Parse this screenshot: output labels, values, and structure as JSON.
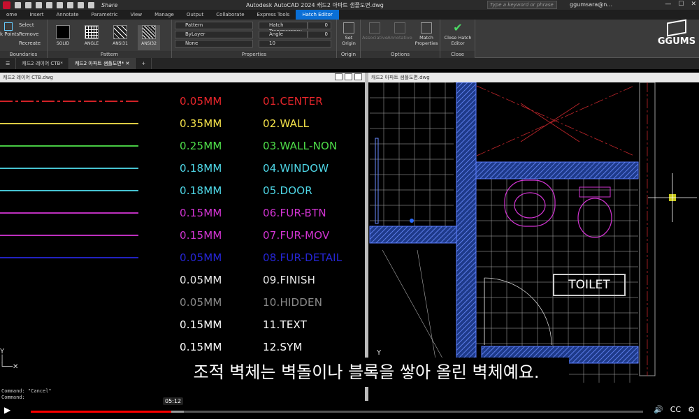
{
  "titlebar": {
    "share_label": "Share",
    "title": "Autodesk AutoCAD 2024    캐드2 아파트 샘플도면.dwg",
    "search_placeholder": "Type a keyword or phrase",
    "user": "ggumsara@n...",
    "min_icon": "minimize-icon",
    "max_icon": "maximize-icon",
    "close_icon": "close-icon"
  },
  "ribbon_tabs": [
    "ome",
    "Insert",
    "Annotate",
    "Parametric",
    "View",
    "Manage",
    "Output",
    "Collaborate",
    "Express Tools",
    "Hatch Editor"
  ],
  "active_tab": "Hatch Editor",
  "ribbon": {
    "boundaries": {
      "label": "Boundaries",
      "pick_points": "k Points",
      "select": "Select",
      "remove": "Remove",
      "recreate": "Recreate"
    },
    "pattern": {
      "label": "Pattern",
      "swatches": [
        "SOLID",
        "ANGLE",
        "ANSI31",
        "ANSI32"
      ]
    },
    "properties": {
      "label": "Properties",
      "type": "Pattern",
      "color": "ByLayer",
      "background": "None",
      "transparency_label": "Hatch Transparency",
      "transparency_value": "0",
      "angle_label": "Angle",
      "angle_value": "0",
      "scale_value": "10"
    },
    "origin": {
      "label": "Origin",
      "set_origin": "Set Origin"
    },
    "options": {
      "label": "Options",
      "associative": "Associative",
      "annotative": "Annotative",
      "match_properties": "Match Properties"
    },
    "close": {
      "label": "Close",
      "close_button": "Close Hatch Editor"
    }
  },
  "brand": "GGUMS",
  "doc_tabs": [
    "캐드2 레이어 CTB*",
    "캐드2 아파트 샘플도면*"
  ],
  "left_pane_title": "캐드2 레이어 CTB.dwg",
  "right_pane_title": "캐드2 아파트 샘플도면.dwg",
  "layers": [
    {
      "weight": "0.05MM",
      "name": "01.CENTER",
      "color": "#e8262b"
    },
    {
      "weight": "0.35MM",
      "name": "02.WALL",
      "color": "#f5e24a"
    },
    {
      "weight": "0.25MM",
      "name": "03.WALL-NON",
      "color": "#4fe04a"
    },
    {
      "weight": "0.18MM",
      "name": "04.WINDOW",
      "color": "#4fd8e8"
    },
    {
      "weight": "0.18MM",
      "name": "05.DOOR",
      "color": "#4fd8e8"
    },
    {
      "weight": "0.15MM",
      "name": "06.FUR-BTN",
      "color": "#d234d2"
    },
    {
      "weight": "0.15MM",
      "name": "07.FUR-MOV",
      "color": "#d234d2"
    },
    {
      "weight": "0.05MM",
      "name": "08.FUR-DETAIL",
      "color": "#2626d6"
    },
    {
      "weight": "0.05MM",
      "name": "09.FINISH",
      "color": "#e8e8e8"
    },
    {
      "weight": "0.05MM",
      "name": "10.HIDDEN",
      "color": "#8a8a8a"
    },
    {
      "weight": "0.15MM",
      "name": "11.TEXT",
      "color": "#ffffff"
    },
    {
      "weight": "0.15MM",
      "name": "12.SYM",
      "color": "#ffffff"
    }
  ],
  "toilet_label": "TOILET",
  "command_lines": [
    "Command: \"Cancel\"",
    "Command:"
  ],
  "subtitle": "조적 벽체는 벽돌이나 블록을 쌓아 올린 벽체예요.",
  "player": {
    "time_tooltip": "05:12",
    "played_fraction": 0.23,
    "buffered_fraction": 0.25
  }
}
